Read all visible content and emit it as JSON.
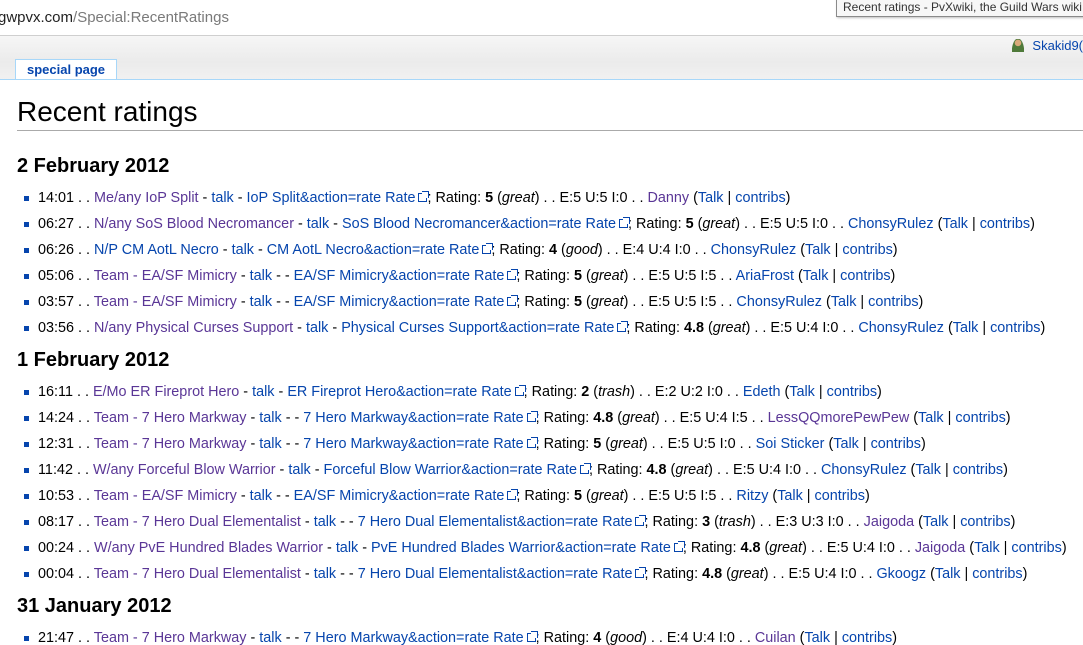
{
  "browser": {
    "url_host": "gwpvx.com",
    "url_path": "/Special:RecentRatings",
    "tab_tooltip": "Recent ratings - PvXwiki, the Guild Wars wiki f"
  },
  "header": {
    "username": "Skakid9(",
    "tab_label": "special page"
  },
  "page": {
    "title": "Recent ratings"
  },
  "days": [
    {
      "date": "2 February 2012",
      "entries": [
        {
          "time": "14:01",
          "build": "Me/any IoP Split",
          "build_visited": true,
          "sep": " - ",
          "rate_link": "IoP Split&action=rate Rate",
          "rating": "5",
          "quality": "great",
          "scores": "E:5 U:5 I:0",
          "user": "Danny",
          "user_visited": true
        },
        {
          "time": "06:27",
          "build": "N/any SoS Blood Necromancer",
          "build_visited": true,
          "sep": " - ",
          "rate_link": "SoS Blood Necromancer&action=rate Rate",
          "rating": "5",
          "quality": "great",
          "scores": "E:5 U:5 I:0",
          "user": "ChonsyRulez",
          "user_visited": false
        },
        {
          "time": "06:26",
          "build": "N/P CM AotL Necro",
          "build_visited": false,
          "sep": " - ",
          "rate_link": "CM AotL Necro&action=rate Rate",
          "rating": "4",
          "quality": "good",
          "scores": "E:4 U:4 I:0",
          "user": "ChonsyRulez",
          "user_visited": false
        },
        {
          "time": "05:06",
          "build": "Team - EA/SF Mimicry",
          "build_visited": true,
          "sep": " - - ",
          "rate_link": "EA/SF Mimicry&action=rate Rate",
          "rating": "5",
          "quality": "great",
          "scores": "E:5 U:5 I:5",
          "user": "AriaFrost",
          "user_visited": false
        },
        {
          "time": "03:57",
          "build": "Team - EA/SF Mimicry",
          "build_visited": true,
          "sep": " - - ",
          "rate_link": "EA/SF Mimicry&action=rate Rate",
          "rating": "5",
          "quality": "great",
          "scores": "E:5 U:5 I:5",
          "user": "ChonsyRulez",
          "user_visited": false
        },
        {
          "time": "03:56",
          "build": "N/any Physical Curses Support",
          "build_visited": true,
          "sep": " - ",
          "rate_link": "Physical Curses Support&action=rate Rate",
          "rating": "4.8",
          "quality": "great",
          "scores": "E:5 U:4 I:0",
          "user": "ChonsyRulez",
          "user_visited": false
        }
      ]
    },
    {
      "date": "1 February 2012",
      "entries": [
        {
          "time": "16:11",
          "build": "E/Mo ER Fireprot Hero",
          "build_visited": true,
          "sep": " - ",
          "rate_link": "ER Fireprot Hero&action=rate Rate",
          "rating": "2",
          "quality": "trash",
          "scores": "E:2 U:2 I:0",
          "user": "Edeth",
          "user_visited": false
        },
        {
          "time": "14:24",
          "build": "Team - 7 Hero Markway",
          "build_visited": true,
          "sep": " - - ",
          "rate_link": "7 Hero Markway&action=rate Rate",
          "rating": "4.8",
          "quality": "great",
          "scores": "E:5 U:4 I:5",
          "user": "LessQQmorePewPew",
          "user_visited": true
        },
        {
          "time": "12:31",
          "build": "Team - 7 Hero Markway",
          "build_visited": true,
          "sep": " - - ",
          "rate_link": "7 Hero Markway&action=rate Rate",
          "rating": "5",
          "quality": "great",
          "scores": "E:5 U:5 I:0",
          "user": "Soi Sticker",
          "user_visited": false
        },
        {
          "time": "11:42",
          "build": "W/any Forceful Blow Warrior",
          "build_visited": true,
          "sep": " - ",
          "rate_link": "Forceful Blow Warrior&action=rate Rate",
          "rating": "4.8",
          "quality": "great",
          "scores": "E:5 U:4 I:0",
          "user": "ChonsyRulez",
          "user_visited": false
        },
        {
          "time": "10:53",
          "build": "Team - EA/SF Mimicry",
          "build_visited": true,
          "sep": " - - ",
          "rate_link": "EA/SF Mimicry&action=rate Rate",
          "rating": "5",
          "quality": "great",
          "scores": "E:5 U:5 I:5",
          "user": "Ritzy",
          "user_visited": false
        },
        {
          "time": "08:17",
          "build": "Team - 7 Hero Dual Elementalist",
          "build_visited": true,
          "sep": " - - ",
          "rate_link": "7 Hero Dual Elementalist&action=rate Rate",
          "rating": "3",
          "quality": "trash",
          "scores": "E:3 U:3 I:0",
          "user": "Jaigoda",
          "user_visited": true
        },
        {
          "time": "00:24",
          "build": "W/any PvE Hundred Blades Warrior",
          "build_visited": true,
          "sep": " - ",
          "rate_link": "PvE Hundred Blades Warrior&action=rate Rate",
          "rating": "4.8",
          "quality": "great",
          "scores": "E:5 U:4 I:0",
          "user": "Jaigoda",
          "user_visited": true
        },
        {
          "time": "00:04",
          "build": "Team - 7 Hero Dual Elementalist",
          "build_visited": true,
          "sep": " - - ",
          "rate_link": "7 Hero Dual Elementalist&action=rate Rate",
          "rating": "4.8",
          "quality": "great",
          "scores": "E:5 U:4 I:0",
          "user": "Gkoogz",
          "user_visited": false
        }
      ]
    },
    {
      "date": "31 January 2012",
      "entries": [
        {
          "time": "21:47",
          "build": "Team - 7 Hero Markway",
          "build_visited": true,
          "sep": " - - ",
          "rate_link": "7 Hero Markway&action=rate Rate",
          "rating": "4",
          "quality": "good",
          "scores": "E:4 U:4 I:0",
          "user": "Cuilan",
          "user_visited": true
        }
      ]
    }
  ],
  "labels": {
    "talk": "talk",
    "rating": "; Rating: ",
    "user_talk": "Talk",
    "contribs": "contribs"
  },
  "colors": {
    "link": "#0645ad",
    "visited_link": "#5a3696",
    "tab_border": "#a7d7f9"
  }
}
